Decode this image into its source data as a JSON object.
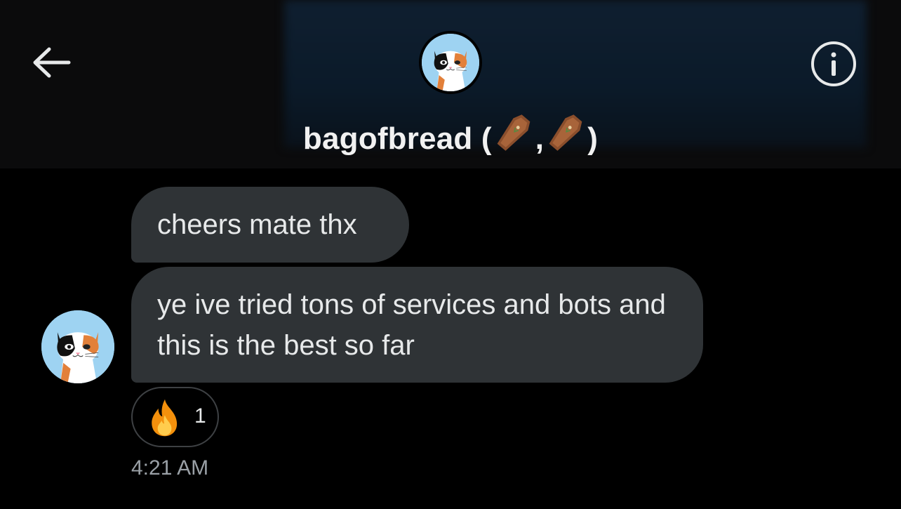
{
  "header": {
    "title_name": "bagofbread",
    "title_open": " (",
    "title_sep": ",",
    "title_close": ")",
    "back_icon": "arrow-left-icon",
    "info_icon": "info-circle-icon",
    "title_emojis": [
      "coffin-emoji",
      "coffin-emoji"
    ]
  },
  "messages": [
    {
      "text": "cheers mate thx"
    },
    {
      "text": "ye ive tried tons of services and bots and this is the best so far"
    }
  ],
  "reaction": {
    "emoji": "fire-emoji",
    "count": "1"
  },
  "timestamp": "4:21 AM",
  "colors": {
    "background": "#000000",
    "header": "#0b0b0c",
    "bubble": "#2f3336",
    "text": "#e7e9ea",
    "muted": "#9aa0a6",
    "avatar_bg": "#9ed3f2"
  }
}
